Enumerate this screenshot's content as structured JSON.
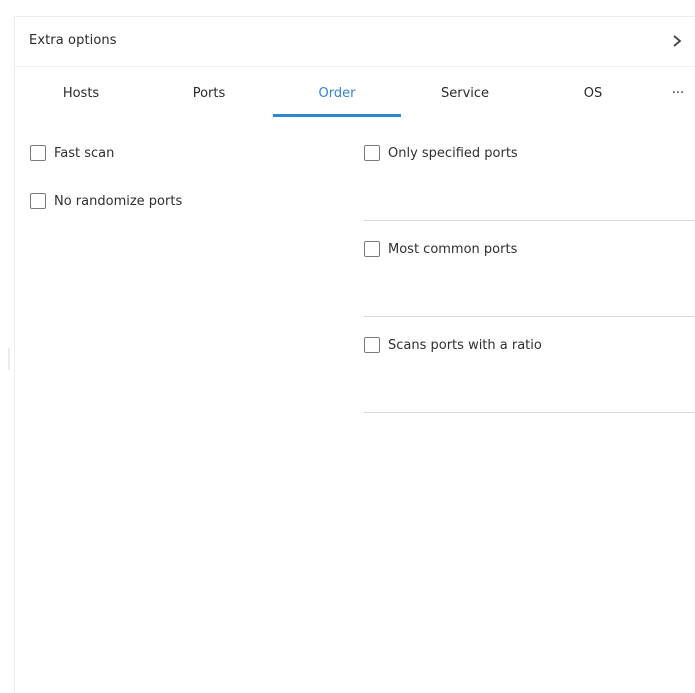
{
  "header": {
    "title": "Extra options",
    "chevron_icon": "chevron-right-icon"
  },
  "tabs": [
    {
      "label": "Hosts",
      "active": false
    },
    {
      "label": "Ports",
      "active": false
    },
    {
      "label": "Order",
      "active": true
    },
    {
      "label": "Service",
      "active": false
    },
    {
      "label": "OS",
      "active": false
    },
    {
      "label": "···",
      "active": false
    }
  ],
  "accent_color": "#2f86d3",
  "left_options": [
    {
      "label": "Fast scan",
      "checked": false
    },
    {
      "label": "No randomize ports",
      "checked": false
    }
  ],
  "right_options": [
    {
      "label": "Only specified ports",
      "checked": false
    },
    {
      "label": "Most common ports",
      "checked": false
    },
    {
      "label": "Scans ports with a ratio",
      "checked": false
    }
  ]
}
